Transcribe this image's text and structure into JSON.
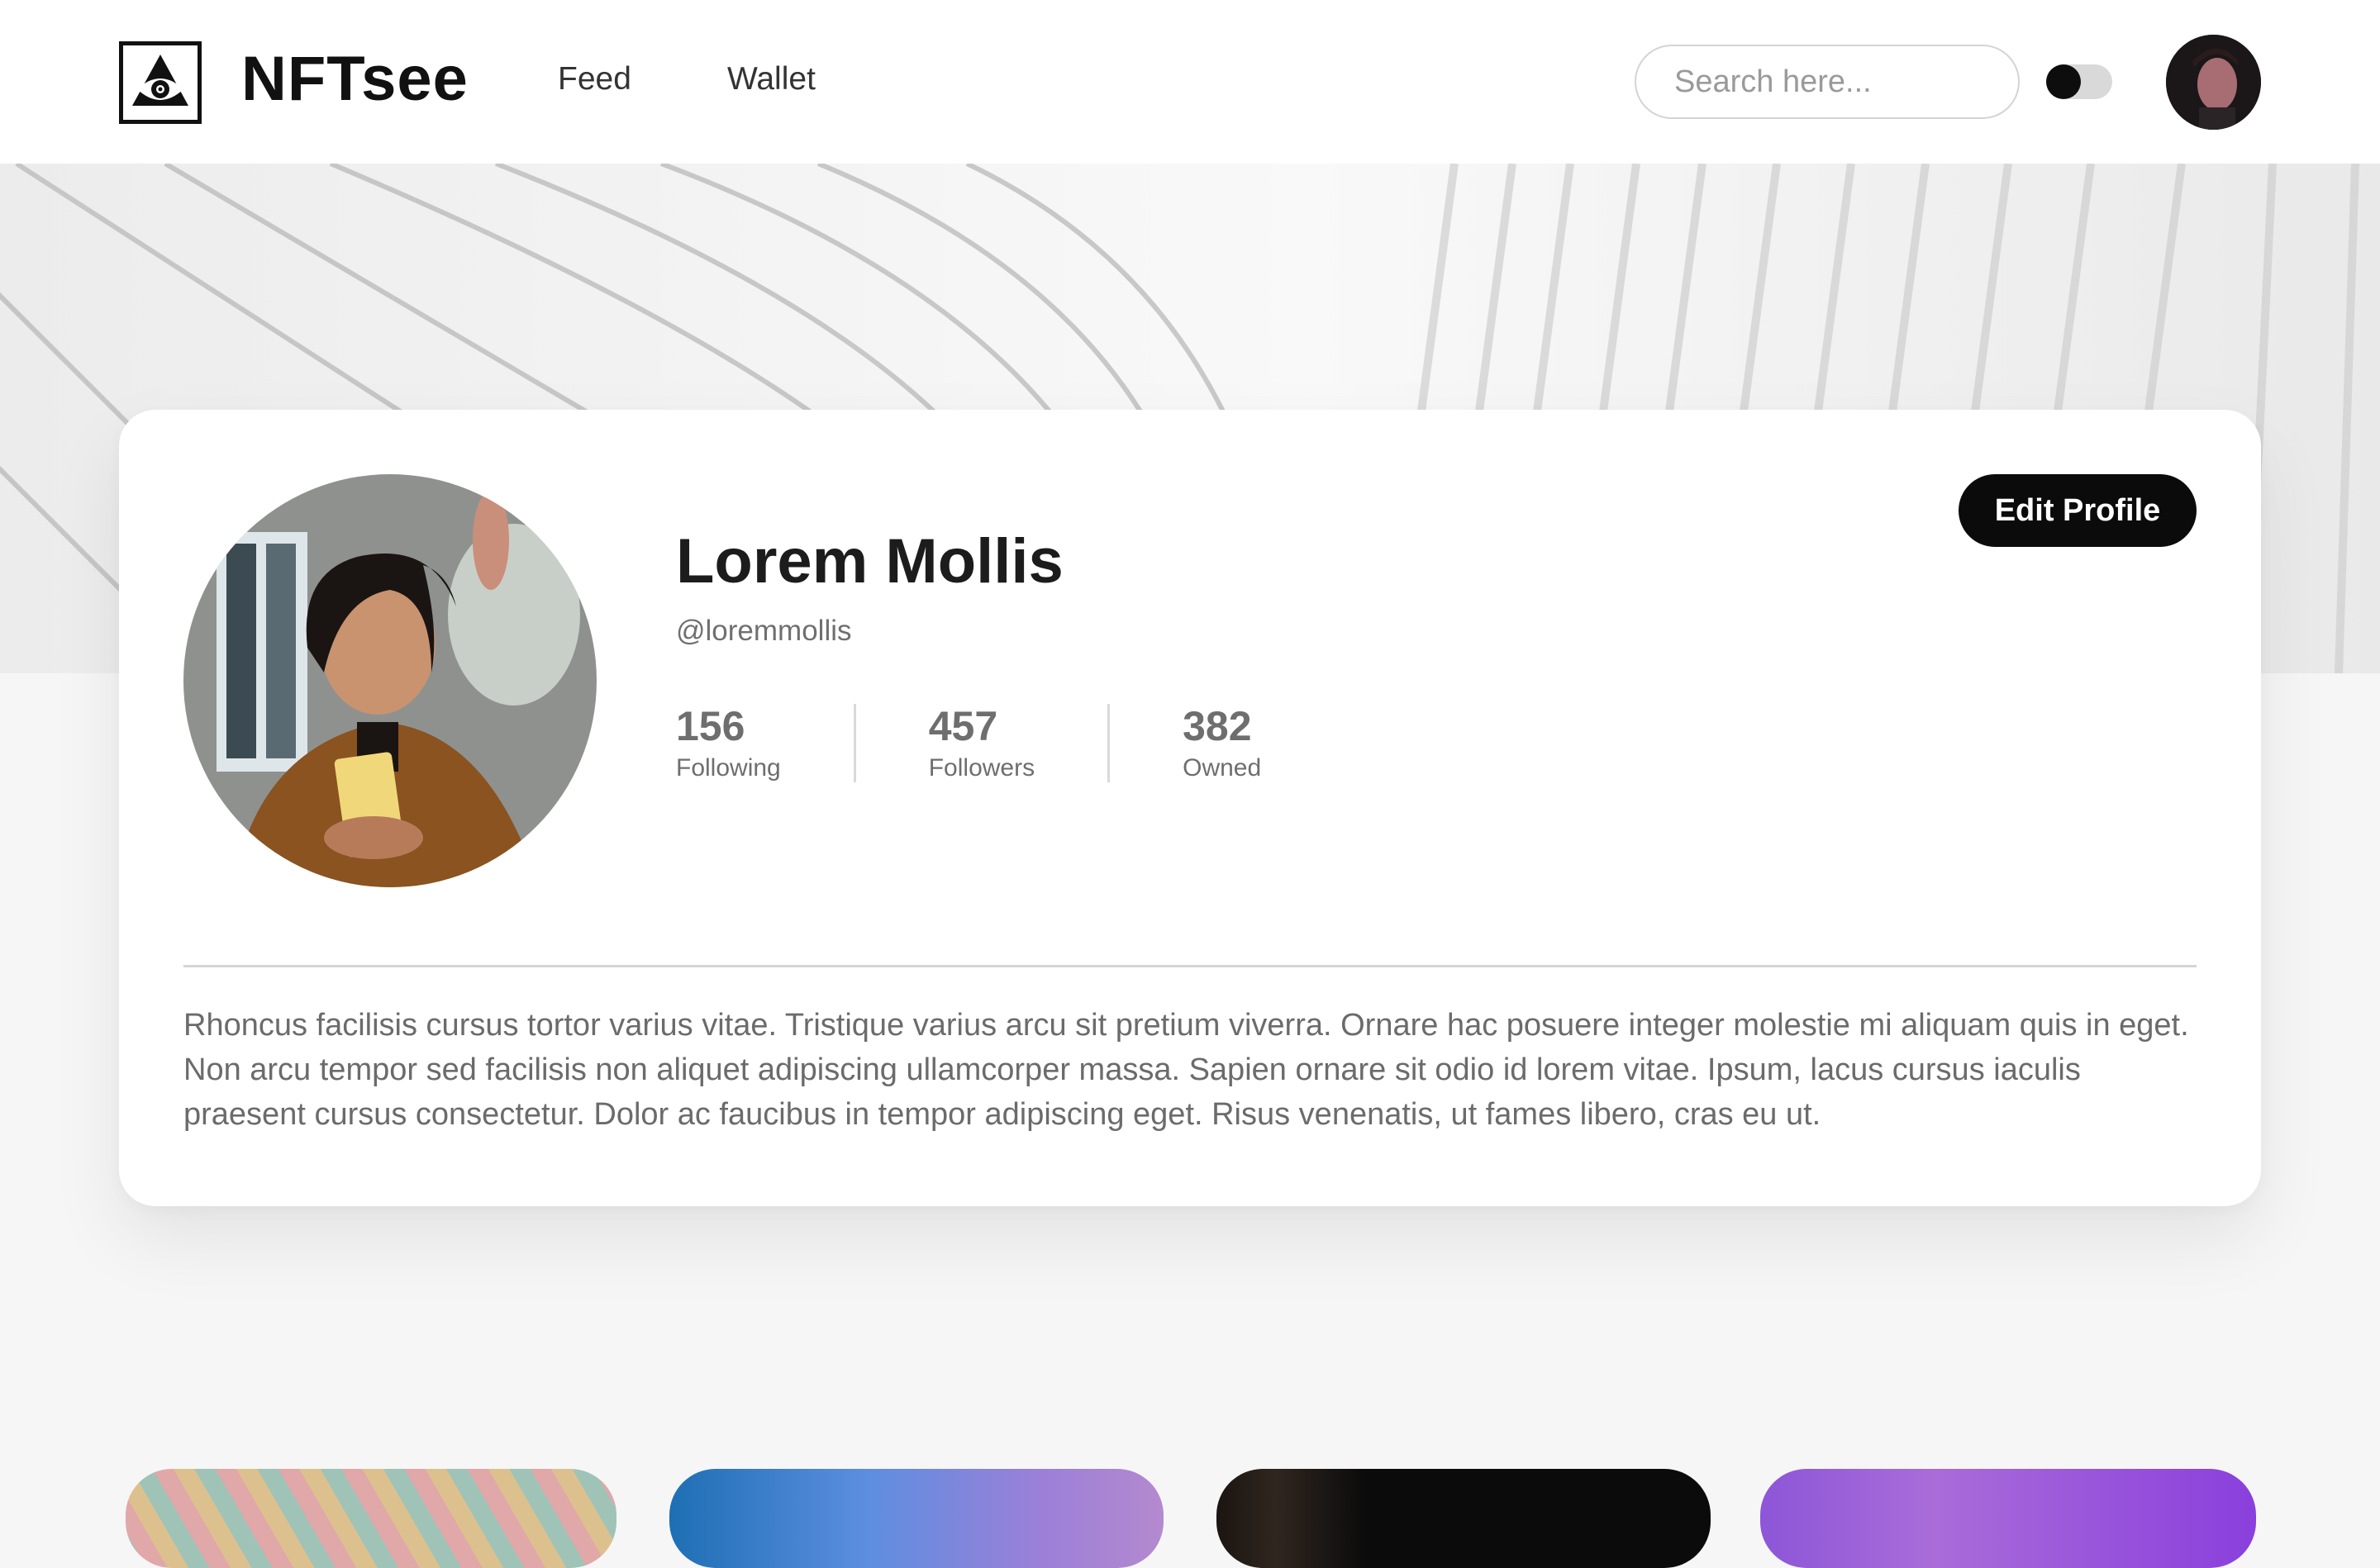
{
  "app": {
    "brand": "NFTsee",
    "logo_icon": "eye-pyramid-icon"
  },
  "nav": {
    "items": [
      {
        "label": "Feed"
      },
      {
        "label": "Wallet"
      }
    ],
    "search_placeholder": "Search here...",
    "theme_toggle": "dark-mode-toggle"
  },
  "profile": {
    "name": "Lorem Mollis",
    "handle": "@loremmollis",
    "edit_label": "Edit Profile",
    "stats": [
      {
        "value": "156",
        "label": "Following"
      },
      {
        "value": "457",
        "label": "Followers"
      },
      {
        "value": "382",
        "label": "Owned"
      }
    ],
    "bio": "Rhoncus facilisis cursus tortor varius vitae. Tristique varius arcu sit pretium viverra. Ornare hac posuere integer molestie mi aliquam quis in eget. Non arcu tempor sed facilisis non aliquet adipiscing ullamcorper massa. Sapien ornare sit odio id lorem vitae. Ipsum, lacus cursus iaculis praesent cursus consectetur. Dolor ac faucibus in tempor adipiscing eget. Risus venenatis, ut fames libero, cras eu ut."
  },
  "colors": {
    "accent": "#0b0b0b",
    "background": "#f6f6f6",
    "card": "#ffffff",
    "muted_text": "#6e6e6e"
  }
}
